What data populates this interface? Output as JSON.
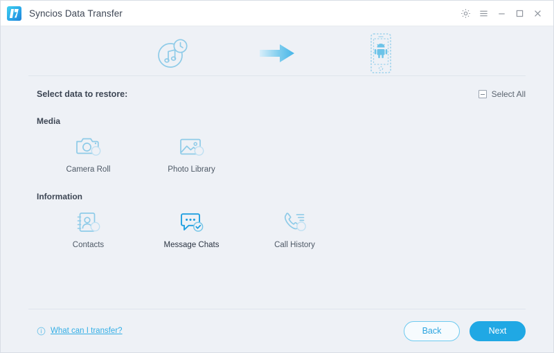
{
  "window": {
    "title": "Syncios Data Transfer",
    "logo_icon": "syncios-logo-icon",
    "controls": [
      {
        "name": "settings-button",
        "icon": "gear-icon"
      },
      {
        "name": "menu-button",
        "icon": "hamburger-menu-icon"
      },
      {
        "name": "minimize-button",
        "icon": "minimize-icon"
      },
      {
        "name": "maximize-button",
        "icon": "maximize-icon"
      },
      {
        "name": "close-button",
        "icon": "close-icon"
      }
    ]
  },
  "flow": {
    "source_icon": "backup-music-clock-icon",
    "arrow_icon": "arrow-right-icon",
    "target_icon": "android-phone-icon"
  },
  "select_bar": {
    "title": "Select data to restore:",
    "select_all_label": "Select All",
    "select_all_state": "indeterminate",
    "select_all_icon": "checkbox-indeterminate-icon"
  },
  "groups": [
    {
      "title": "Media",
      "items": [
        {
          "label": "Camera Roll",
          "icon": "camera-icon",
          "selected": false
        },
        {
          "label": "Photo Library",
          "icon": "photo-library-icon",
          "selected": false
        }
      ]
    },
    {
      "title": "Information",
      "items": [
        {
          "label": "Contacts",
          "icon": "contacts-icon",
          "selected": false
        },
        {
          "label": "Message Chats",
          "icon": "message-chats-icon",
          "selected": true
        },
        {
          "label": "Call History",
          "icon": "call-history-icon",
          "selected": false
        }
      ]
    }
  ],
  "footer": {
    "help_label": "What can I transfer?",
    "help_icon": "info-icon",
    "back_label": "Back",
    "next_label": "Next"
  },
  "colors": {
    "accent": "#20a8e4",
    "icon_idle": "#8ecbe8",
    "icon_selected": "#1f9fe0",
    "link": "#33aee6",
    "page_bg": "#eef1f6",
    "titlebar_bg": "#ffffff"
  }
}
